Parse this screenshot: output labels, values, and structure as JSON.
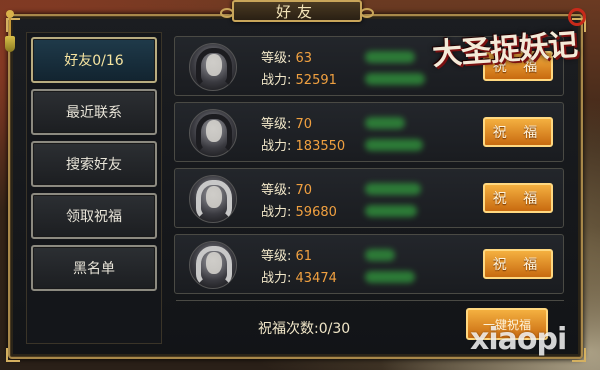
{
  "title": "好友",
  "logo_text": "大圣捉妖记",
  "watermark": "xiaopi",
  "sidebar": {
    "items": [
      {
        "label": "好友0/16",
        "active": true
      },
      {
        "label": "最近联系",
        "active": false
      },
      {
        "label": "搜索好友",
        "active": false
      },
      {
        "label": "领取祝福",
        "active": false
      },
      {
        "label": "黑名单",
        "active": false
      }
    ]
  },
  "friends": [
    {
      "level_label": "等级:",
      "level": "63",
      "power_label": "战力:",
      "power": "52591",
      "bless_label": "祝 福",
      "avatar": "dark-armored-warrior"
    },
    {
      "level_label": "等级:",
      "level": "70",
      "power_label": "战力:",
      "power": "183550",
      "bless_label": "祝 福",
      "avatar": "dark-armored-warrior"
    },
    {
      "level_label": "等级:",
      "level": "70",
      "power_label": "战力:",
      "power": "59680",
      "bless_label": "祝 福",
      "avatar": "white-haired-swordsman"
    },
    {
      "level_label": "等级:",
      "level": "61",
      "power_label": "战力:",
      "power": "43474",
      "bless_label": "祝 福",
      "avatar": "white-haired-swordsman"
    }
  ],
  "footer": {
    "count_label": "祝福次数:",
    "count_value": "0/30",
    "bless_all_label": "一键祝福"
  },
  "colors": {
    "frame_gold": "#a8884a",
    "value_orange": "#f0a040",
    "button_orange": "#e08a20",
    "active_tab": "#1f3a4a",
    "blurred_name_green": "#2f8a3a"
  }
}
